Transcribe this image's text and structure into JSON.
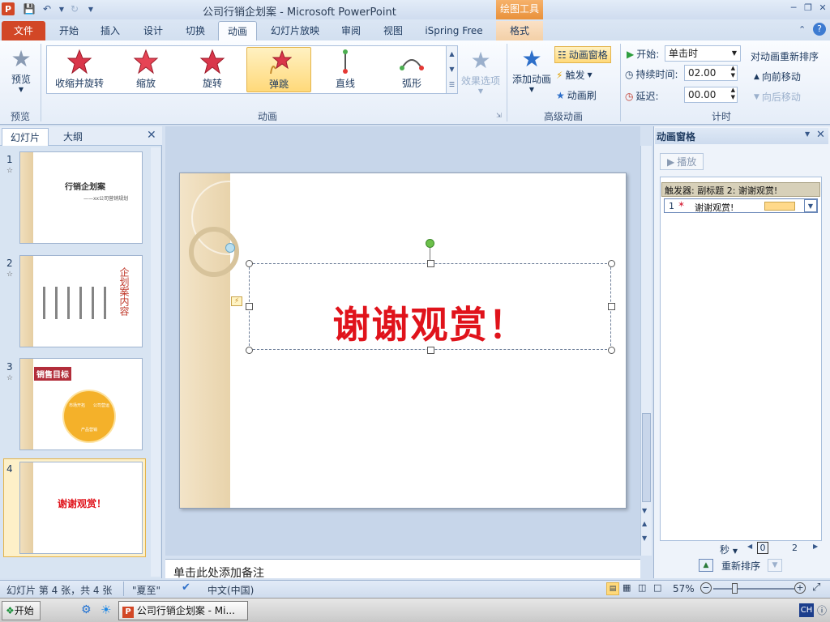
{
  "window": {
    "title": "公司行销企划案 - Microsoft PowerPoint",
    "context_tool": "绘图工具"
  },
  "tabs": [
    {
      "label": "文件"
    },
    {
      "label": "开始"
    },
    {
      "label": "插入"
    },
    {
      "label": "设计"
    },
    {
      "label": "切换"
    },
    {
      "label": "动画"
    },
    {
      "label": "幻灯片放映"
    },
    {
      "label": "审阅"
    },
    {
      "label": "视图"
    },
    {
      "label": "iSpring Free"
    },
    {
      "label": "格式"
    }
  ],
  "ribbon": {
    "preview": {
      "label": "预览",
      "group": "预览"
    },
    "animations": [
      {
        "label": "收缩并旋转"
      },
      {
        "label": "缩放"
      },
      {
        "label": "旋转"
      },
      {
        "label": "弹跳"
      },
      {
        "label": "直线"
      },
      {
        "label": "弧形"
      }
    ],
    "effect_options": "效果选项",
    "group_animation": "动画",
    "add_animation": "添加动画",
    "animation_pane_btn": "动画窗格",
    "trigger": "触发",
    "painter": "动画刷",
    "group_advanced": "高级动画",
    "start_label": "开始:",
    "start_value": "单击时",
    "duration_label": "持续时间:",
    "duration_value": "02.00",
    "delay_label": "延迟:",
    "delay_value": "00.00",
    "reorder_title": "对动画重新排序",
    "move_earlier": "向前移动",
    "move_later": "向后移动",
    "group_timing": "计时"
  },
  "left_pane": {
    "tab_slides": "幻灯片",
    "tab_outline": "大纲",
    "slides": [
      {
        "num": "1",
        "title": "行销企划案",
        "subtitle": "——xx公司营销规划"
      },
      {
        "num": "2",
        "title": "企划案内容"
      },
      {
        "num": "3",
        "title": "销售目标",
        "seg1": "市场开拓",
        "seg2": "公司营运",
        "seg3": "产品营销"
      },
      {
        "num": "4",
        "title": "谢谢观赏！"
      }
    ]
  },
  "slide": {
    "text": "谢谢观赏！"
  },
  "notes": {
    "placeholder": "单击此处添加备注"
  },
  "anim_pane": {
    "title": "动画窗格",
    "play": "播放",
    "trigger_row": "触发器: 副标题 2: 谢谢观赏!",
    "item_num": "1",
    "item_label": "谢谢观赏!",
    "timeline_unit": "秒",
    "timeline_start": "0",
    "timeline_end": "2",
    "reorder": "重新排序"
  },
  "status": {
    "slide_info": "幻灯片 第 4 张，共 4 张",
    "theme": "\"夏至\"",
    "language": "中文(中国)",
    "zoom": "57%"
  },
  "taskbar": {
    "start": "开始",
    "window": "公司行销企划案 - Mi...",
    "ime": "CH"
  }
}
